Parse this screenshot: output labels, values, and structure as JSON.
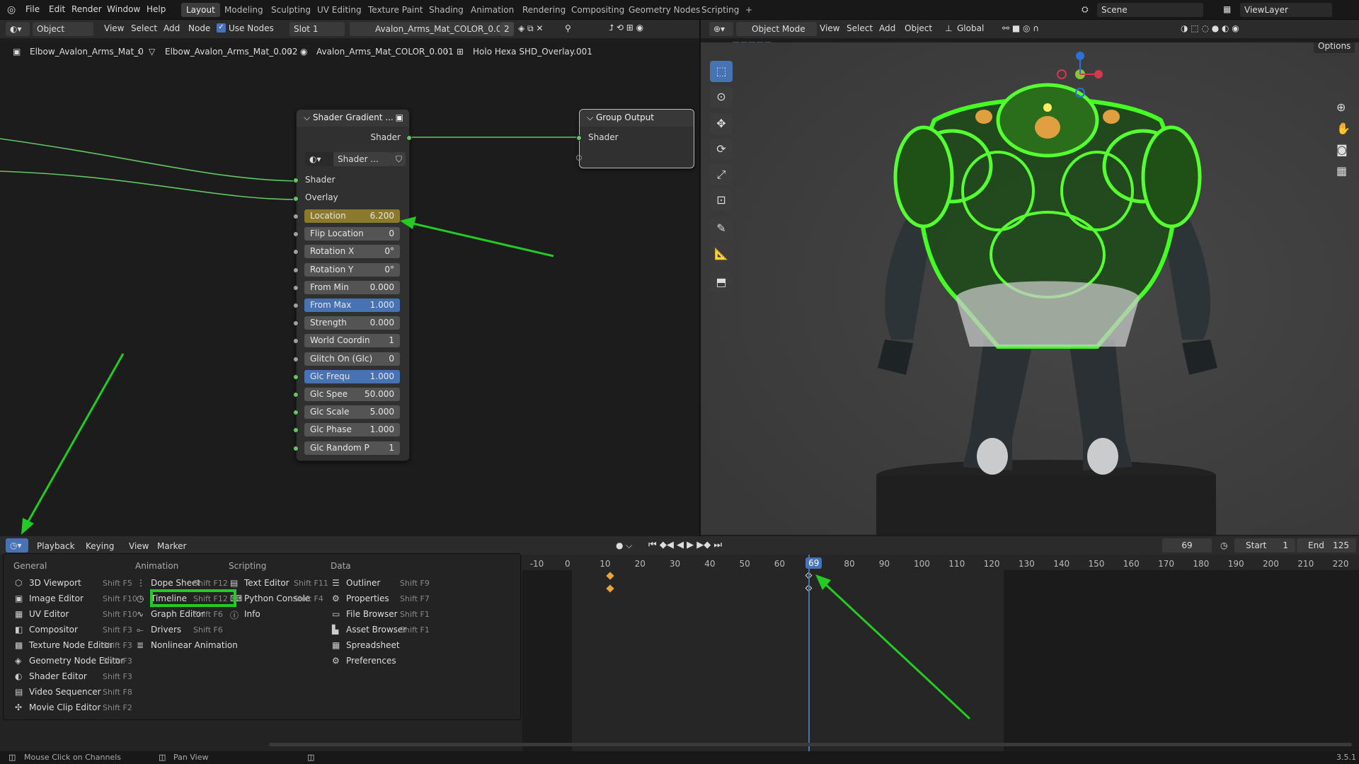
{
  "topbar": {
    "menus": [
      "File",
      "Edit",
      "Render",
      "Window",
      "Help"
    ],
    "workspaces": [
      "Layout",
      "Modeling",
      "Sculpting",
      "UV Editing",
      "Texture Paint",
      "Shading",
      "Animation",
      "Rendering",
      "Compositing",
      "Geometry Nodes",
      "Scripting"
    ],
    "active_workspace": "Layout",
    "add_tab": "+",
    "scene": "Scene",
    "view_layer": "ViewLayer"
  },
  "node_header": {
    "object_label": "Object",
    "view": "View",
    "select": "Select",
    "add": "Add",
    "node": "Node",
    "use_nodes": "Use Nodes",
    "slot": "Slot 1",
    "material": "Avalon_Arms_Mat_COLOR_0.001",
    "user_count": "2"
  },
  "breadcrumb": [
    "Elbow_Avalon_Arms_Mat_0",
    "Elbow_Avalon_Arms_Mat_0.002",
    "Avalon_Arms_Mat_COLOR_0.001",
    "Holo Hexa SHD_Overlay.001"
  ],
  "node_group": {
    "title": "Shader Gradient ...",
    "output": "Shader",
    "subgroup": "Shader ...",
    "inputs_plain": [
      "Shader",
      "Overlay"
    ],
    "fields": [
      {
        "label": "Location",
        "value": "6.200",
        "style": "yellow"
      },
      {
        "label": "Flip Location",
        "value": "0",
        "style": ""
      },
      {
        "label": "Rotation X",
        "value": "0°",
        "style": ""
      },
      {
        "label": "Rotation Y",
        "value": "0°",
        "style": ""
      },
      {
        "label": "From Min",
        "value": "0.000",
        "style": ""
      },
      {
        "label": "From Max",
        "value": "1.000",
        "style": "blue"
      },
      {
        "label": "Strength",
        "value": "0.000",
        "style": ""
      },
      {
        "label": "World Coordin",
        "value": "1",
        "style": ""
      },
      {
        "label": "Glitch On (Glc)",
        "value": "0",
        "style": ""
      },
      {
        "label": "Glc Frequ",
        "value": "1.000",
        "style": "blue"
      },
      {
        "label": "Glc Spee",
        "value": "50.000",
        "style": ""
      },
      {
        "label": "Glc Scale",
        "value": "5.000",
        "style": ""
      },
      {
        "label": "Glc Phase",
        "value": "1.000",
        "style": ""
      },
      {
        "label": "Glc Random P",
        "value": "1",
        "style": ""
      }
    ]
  },
  "group_output": {
    "title": "Group Output",
    "input": "Shader"
  },
  "viewport_header": {
    "mode": "Object Mode",
    "view": "View",
    "select": "Select",
    "add": "Add",
    "object": "Object",
    "orientation": "Global",
    "options": "Options"
  },
  "timeline_header": {
    "playback": "Playback",
    "keying": "Keying",
    "view": "View",
    "marker": "Marker",
    "current_frame": "69",
    "start_label": "Start",
    "start": "1",
    "end_label": "End",
    "end": "125"
  },
  "frame_ticks": [
    "-10",
    "0",
    "10",
    "20",
    "30",
    "40",
    "50",
    "60",
    "69",
    "80",
    "90",
    "100",
    "110",
    "120",
    "130",
    "140",
    "150",
    "160",
    "170",
    "180",
    "190",
    "200",
    "210",
    "220"
  ],
  "editor_menu": {
    "columns": [
      {
        "title": "General",
        "items": [
          {
            "label": "3D Viewport",
            "key": "Shift F5",
            "icon": "viewport-icon"
          },
          {
            "label": "Image Editor",
            "key": "Shift F10",
            "icon": "image-icon"
          },
          {
            "label": "UV Editor",
            "key": "Shift F10",
            "icon": "uv-icon"
          },
          {
            "label": "Compositor",
            "key": "Shift F3",
            "icon": "compositor-icon"
          },
          {
            "label": "Texture Node Editor",
            "key": "Shift F3",
            "icon": "texture-icon"
          },
          {
            "label": "Geometry Node Editor",
            "key": "Shift F3",
            "icon": "geonodes-icon"
          },
          {
            "label": "Shader Editor",
            "key": "Shift F3",
            "icon": "shader-icon"
          },
          {
            "label": "Video Sequencer",
            "key": "Shift F8",
            "icon": "sequencer-icon"
          },
          {
            "label": "Movie Clip Editor",
            "key": "Shift F2",
            "icon": "clip-icon"
          }
        ]
      },
      {
        "title": "Animation",
        "items": [
          {
            "label": "Dope Sheet",
            "key": "Shift F12",
            "icon": "dopesheet-icon"
          },
          {
            "label": "Timeline",
            "key": "Shift F12",
            "icon": "timeline-icon"
          },
          {
            "label": "Graph Editor",
            "key": "Shift F6",
            "icon": "graph-icon"
          },
          {
            "label": "Drivers",
            "key": "Shift F6",
            "icon": "drivers-icon"
          },
          {
            "label": "Nonlinear Animation",
            "key": "",
            "icon": "nla-icon"
          }
        ]
      },
      {
        "title": "Scripting",
        "items": [
          {
            "label": "Text Editor",
            "key": "Shift F11",
            "icon": "text-icon"
          },
          {
            "label": "Python Console",
            "key": "Shift F4",
            "icon": "console-icon"
          },
          {
            "label": "Info",
            "key": "",
            "icon": "info-icon"
          }
        ]
      },
      {
        "title": "Data",
        "items": [
          {
            "label": "Outliner",
            "key": "Shift F9",
            "icon": "outliner-icon"
          },
          {
            "label": "Properties",
            "key": "Shift F7",
            "icon": "properties-icon"
          },
          {
            "label": "File Browser",
            "key": "Shift F1",
            "icon": "filebrowser-icon"
          },
          {
            "label": "Asset Browser",
            "key": "Shift F1",
            "icon": "asset-icon"
          },
          {
            "label": "Spreadsheet",
            "key": "",
            "icon": "spreadsheet-icon"
          },
          {
            "label": "Preferences",
            "key": "",
            "icon": "preferences-icon"
          }
        ]
      }
    ]
  },
  "status_bar": {
    "left": "Mouse Click on Channels",
    "middle": "Pan View",
    "version": "3.5.1"
  },
  "colors": {
    "accent": "#4772b3",
    "highlight_green": "#22cc22",
    "keyframe": "#e8a33b",
    "socket_green": "#63c763"
  }
}
